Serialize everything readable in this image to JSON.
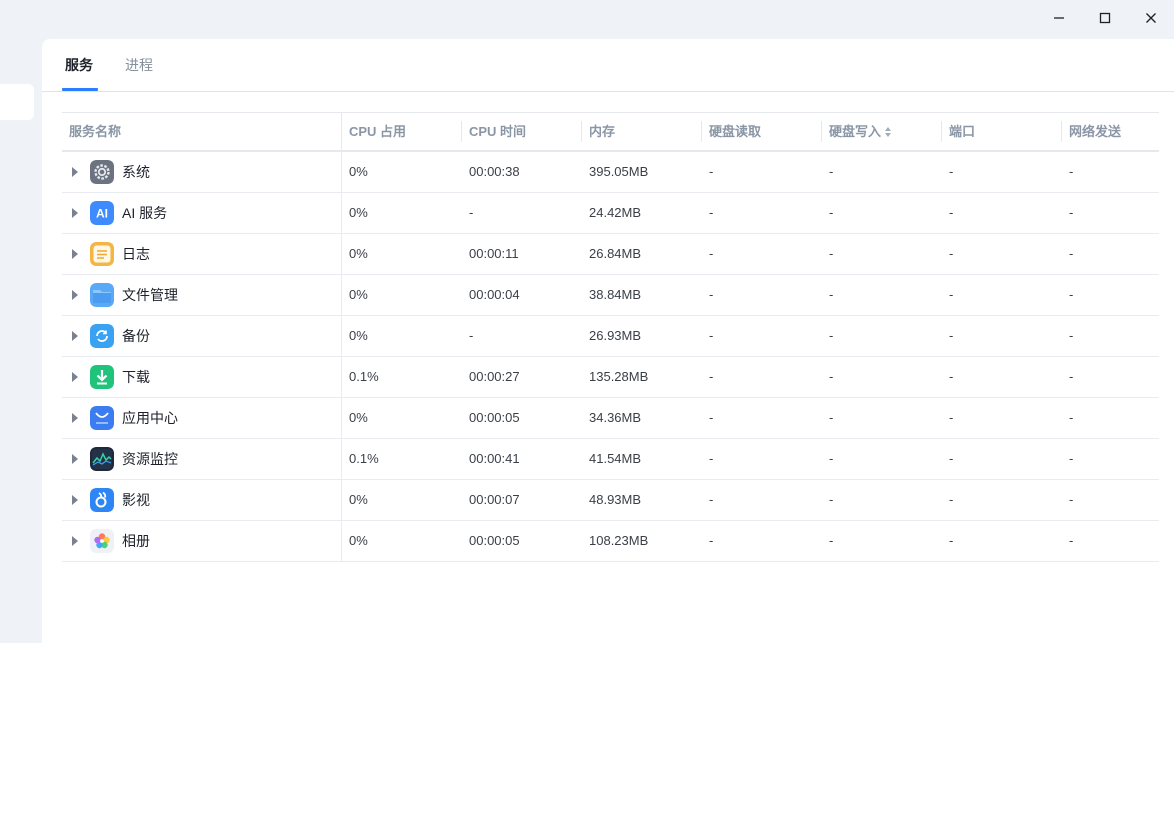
{
  "window_controls": {
    "minimize_icon": "minimize-icon",
    "maximize_icon": "maximize-icon",
    "close_icon": "close-icon"
  },
  "tabs": [
    {
      "label": "服务",
      "active": true
    },
    {
      "label": "进程",
      "active": false
    }
  ],
  "accent_color": "#2b7fff",
  "columns": {
    "name": "服务名称",
    "cpu_usage": "CPU 占用",
    "cpu_time": "CPU 时间",
    "memory": "内存",
    "disk_read": "硬盘读取",
    "disk_write": "硬盘写入",
    "port": "端口",
    "net_send": "网络发送"
  },
  "sort": {
    "column": "disk_write",
    "icon": "sort-icon"
  },
  "rows": [
    {
      "name": "系统",
      "icon": "gear-icon",
      "cpu": "0%",
      "cpu_time": "00:00:38",
      "memory": "395.05MB",
      "disk_read": "-",
      "disk_write": "-",
      "port": "-",
      "net_send": "-"
    },
    {
      "name": "AI 服务",
      "icon": "ai-icon",
      "cpu": "0%",
      "cpu_time": "-",
      "memory": "24.42MB",
      "disk_read": "-",
      "disk_write": "-",
      "port": "-",
      "net_send": "-"
    },
    {
      "name": "日志",
      "icon": "log-icon",
      "cpu": "0%",
      "cpu_time": "00:00:11",
      "memory": "26.84MB",
      "disk_read": "-",
      "disk_write": "-",
      "port": "-",
      "net_send": "-"
    },
    {
      "name": "文件管理",
      "icon": "folder-icon",
      "cpu": "0%",
      "cpu_time": "00:00:04",
      "memory": "38.84MB",
      "disk_read": "-",
      "disk_write": "-",
      "port": "-",
      "net_send": "-"
    },
    {
      "name": "备份",
      "icon": "backup-icon",
      "cpu": "0%",
      "cpu_time": "-",
      "memory": "26.93MB",
      "disk_read": "-",
      "disk_write": "-",
      "port": "-",
      "net_send": "-"
    },
    {
      "name": "下载",
      "icon": "download-icon",
      "cpu": "0.1%",
      "cpu_time": "00:00:27",
      "memory": "135.28MB",
      "disk_read": "-",
      "disk_write": "-",
      "port": "-",
      "net_send": "-"
    },
    {
      "name": "应用中心",
      "icon": "app-store-icon",
      "cpu": "0%",
      "cpu_time": "00:00:05",
      "memory": "34.36MB",
      "disk_read": "-",
      "disk_write": "-",
      "port": "-",
      "net_send": "-"
    },
    {
      "name": "资源监控",
      "icon": "monitor-icon",
      "cpu": "0.1%",
      "cpu_time": "00:00:41",
      "memory": "41.54MB",
      "disk_read": "-",
      "disk_write": "-",
      "port": "-",
      "net_send": "-"
    },
    {
      "name": "影视",
      "icon": "video-icon",
      "cpu": "0%",
      "cpu_time": "00:00:07",
      "memory": "48.93MB",
      "disk_read": "-",
      "disk_write": "-",
      "port": "-",
      "net_send": "-"
    },
    {
      "name": "相册",
      "icon": "photos-icon",
      "cpu": "0%",
      "cpu_time": "00:00:05",
      "memory": "108.23MB",
      "disk_read": "-",
      "disk_write": "-",
      "port": "-",
      "net_send": "-"
    }
  ]
}
